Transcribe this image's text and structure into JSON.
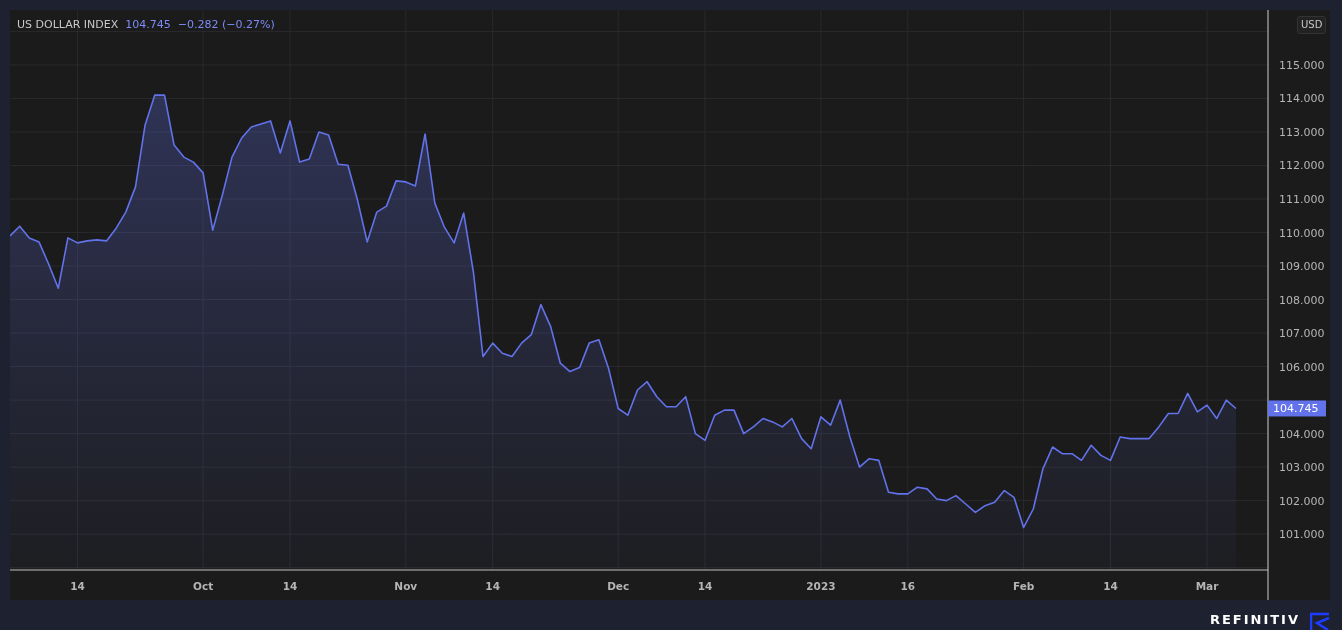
{
  "chart": {
    "last_value": "104.745",
    "change": "−0.282 (−0.27%)",
    "currency": "USD",
    "price_label": "104.745",
    "chart_data": {
      "type": "area",
      "grid": true,
      "categories": [
        null,
        null,
        null,
        null,
        null,
        null,
        null,
        "14",
        null,
        null,
        null,
        null,
        null,
        null,
        null,
        null,
        null,
        null,
        null,
        null,
        "Oct",
        null,
        null,
        null,
        null,
        null,
        null,
        null,
        null,
        "14",
        null,
        null,
        null,
        null,
        null,
        null,
        null,
        null,
        null,
        null,
        null,
        "Nov",
        null,
        null,
        null,
        null,
        null,
        null,
        null,
        null,
        "14",
        null,
        null,
        null,
        null,
        null,
        null,
        null,
        null,
        null,
        null,
        null,
        null,
        "Dec",
        null,
        null,
        null,
        null,
        null,
        null,
        null,
        null,
        "14",
        null,
        null,
        null,
        null,
        null,
        null,
        null,
        null,
        null,
        null,
        null,
        "2023",
        null,
        null,
        null,
        null,
        null,
        null,
        null,
        null,
        "16",
        null,
        null,
        null,
        null,
        null,
        null,
        null,
        null,
        null,
        null,
        null,
        "Feb",
        null,
        null,
        null,
        null,
        null,
        null,
        null,
        null,
        "14",
        null,
        null,
        null,
        null,
        null,
        null,
        null,
        null,
        null,
        "Mar",
        null,
        null,
        null
      ],
      "series": [
        {
          "name": "US DOLLAR INDEX",
          "color": "#6272ea",
          "values": [
            109.9,
            110.19,
            109.84,
            109.72,
            109.06,
            108.34,
            109.84,
            109.69,
            109.75,
            109.78,
            109.75,
            110.13,
            110.61,
            111.36,
            113.21,
            114.1,
            114.1,
            112.61,
            112.25,
            112.1,
            111.78,
            110.07,
            111.12,
            112.25,
            112.82,
            113.15,
            113.24,
            113.33,
            112.37,
            113.33,
            112.1,
            112.19,
            113.0,
            112.91,
            112.04,
            112.01,
            110.97,
            109.72,
            110.61,
            110.79,
            111.54,
            111.51,
            111.39,
            112.94,
            110.88,
            110.16,
            109.69,
            110.58,
            108.82,
            106.3,
            106.7,
            106.4,
            106.3,
            106.7,
            106.95,
            107.85,
            107.2,
            106.1,
            105.85,
            105.97,
            106.7,
            106.8,
            105.95,
            104.75,
            104.55,
            105.3,
            105.55,
            105.1,
            104.8,
            104.8,
            105.1,
            104.0,
            103.8,
            104.55,
            104.7,
            104.7,
            104.0,
            104.2,
            104.45,
            104.35,
            104.2,
            104.45,
            103.85,
            103.55,
            104.5,
            104.25,
            105.0,
            103.9,
            103.0,
            103.25,
            103.2,
            102.25,
            102.2,
            102.2,
            102.4,
            102.35,
            102.05,
            102.0,
            102.15,
            101.9,
            101.65,
            101.85,
            101.95,
            102.3,
            102.1,
            101.2,
            101.75,
            102.95,
            103.6,
            103.4,
            103.4,
            103.2,
            103.65,
            103.35,
            103.2,
            103.9,
            103.85,
            103.85,
            103.85,
            104.2,
            104.6,
            104.6,
            105.2,
            104.65,
            104.85,
            104.45,
            105.0,
            104.75
          ]
        }
      ],
      "ylim": [
        99.93,
        116.64
      ],
      "yticks": [
        {
          "value": 101,
          "label": "101.000"
        },
        {
          "value": 102,
          "label": "102.000"
        },
        {
          "value": 103,
          "label": "103.000"
        },
        {
          "value": 104,
          "label": "104.000"
        },
        {
          "value": 106,
          "label": "106.000"
        },
        {
          "value": 107,
          "label": "107.000"
        },
        {
          "value": 108,
          "label": "108.000"
        },
        {
          "value": 109,
          "label": "109.000"
        },
        {
          "value": 110,
          "label": "110.000"
        },
        {
          "value": 111,
          "label": "111.000"
        },
        {
          "value": 112,
          "label": "112.000"
        },
        {
          "value": 113,
          "label": "113.000"
        },
        {
          "value": 114,
          "label": "114.000"
        },
        {
          "value": 115,
          "label": "115.000"
        }
      ]
    }
  },
  "footer": {
    "brand": "REFINITIV"
  }
}
